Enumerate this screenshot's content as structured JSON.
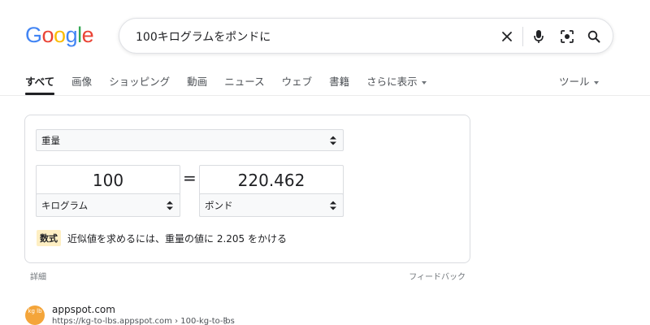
{
  "logo": {
    "letters": [
      "G",
      "o",
      "o",
      "g",
      "l",
      "e"
    ],
    "colors": [
      "#4285f4",
      "#ea4335",
      "#fbbc05",
      "#4285f4",
      "#34a853",
      "#ea4335"
    ]
  },
  "search": {
    "query": "100キログラムをポンドに",
    "icons": [
      "close-icon",
      "mic-icon",
      "lens-icon",
      "search-icon"
    ]
  },
  "tabs": [
    {
      "label": "すべて",
      "active": true
    },
    {
      "label": "画像"
    },
    {
      "label": "ショッピング"
    },
    {
      "label": "動画"
    },
    {
      "label": "ニュース"
    },
    {
      "label": "ウェブ"
    },
    {
      "label": "書籍"
    },
    {
      "label": "さらに表示"
    }
  ],
  "tools_label": "ツール",
  "converter": {
    "quantity": "重量",
    "from_value": "100",
    "from_unit": "キログラム",
    "equals": "=",
    "to_value": "220.462",
    "to_unit": "ポンド",
    "formula_badge": "数式",
    "formula_text": "近似値を求めるには、重量の値に 2.205 をかける"
  },
  "details_label": "詳細",
  "feedback_label": "フィードバック",
  "result": {
    "favicon_text": "kg lb",
    "site": "appspot.com",
    "cite": "https://kg-to-lbs.appspot.com › 100-kg-to-lbs",
    "more": "⋮"
  },
  "colors": {
    "accent": "#1a73e8",
    "badge_bg": "#feefc3",
    "favicon_bg": "#f4a53a"
  }
}
